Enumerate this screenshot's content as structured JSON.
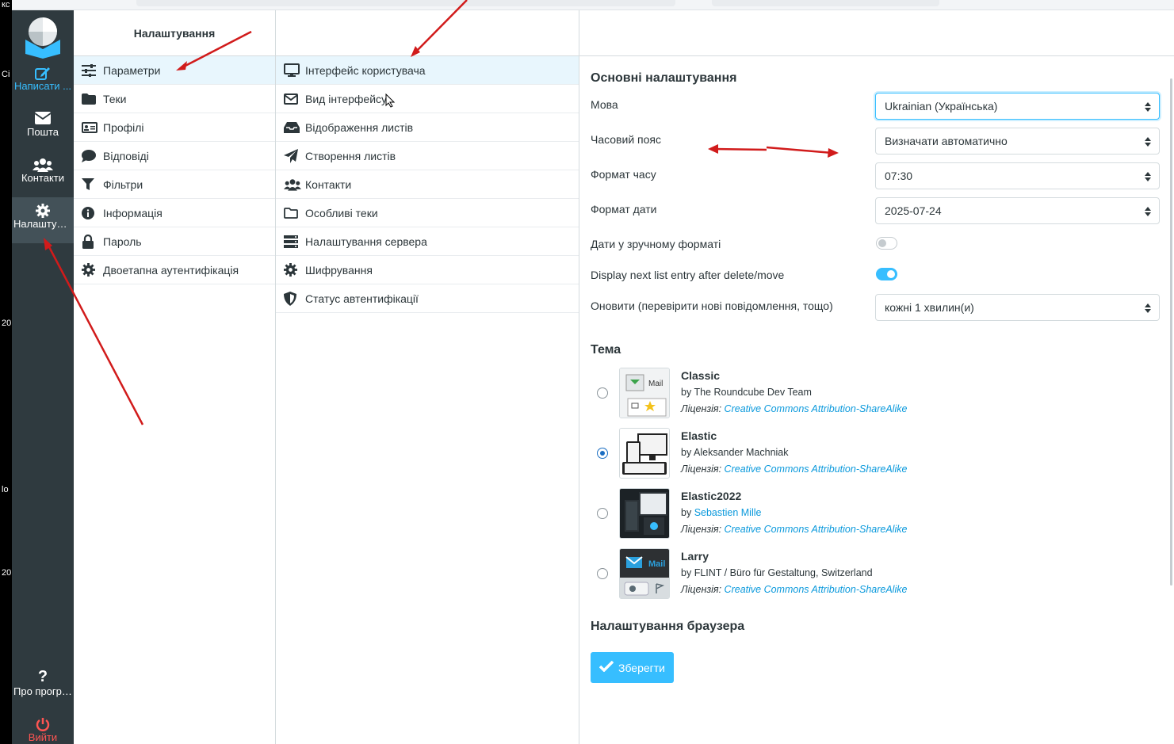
{
  "desktop_strip": {
    "fragments": [
      "кс",
      "Сі",
      "20",
      "lo",
      "20"
    ]
  },
  "rail": {
    "items": [
      {
        "label": "Написати ...",
        "icon": "compose-icon"
      },
      {
        "label": "Пошта",
        "icon": "mail-icon"
      },
      {
        "label": "Контакти",
        "icon": "contacts-icon"
      },
      {
        "label": "Налаштува...",
        "icon": "gear-icon"
      }
    ],
    "about_label": "Про програ...",
    "logout_label": "Вийти",
    "colors": {
      "accent": "#37beff",
      "bg": "#2f3a3f",
      "active_bg": "#435158",
      "logout": "#ff5552"
    }
  },
  "settings": {
    "title": "Налаштування",
    "items": [
      {
        "label": "Параметри",
        "icon": "sliders-icon"
      },
      {
        "label": "Теки",
        "icon": "folder-icon"
      },
      {
        "label": "Профілі",
        "icon": "id-card-icon"
      },
      {
        "label": "Відповіді",
        "icon": "comment-icon"
      },
      {
        "label": "Фільтри",
        "icon": "filter-icon"
      },
      {
        "label": "Інформація",
        "icon": "info-icon"
      },
      {
        "label": "Пароль",
        "icon": "lock-icon"
      },
      {
        "label": "Двоетапна аутентифікація",
        "icon": "gear-icon"
      }
    ]
  },
  "sections": {
    "items": [
      {
        "label": "Інтерфейс користувача",
        "icon": "monitor-icon"
      },
      {
        "label": "Вид інтерфейсу",
        "icon": "envelope-icon"
      },
      {
        "label": "Відображення листів",
        "icon": "inbox-icon"
      },
      {
        "label": "Створення листів",
        "icon": "paper-plane-icon"
      },
      {
        "label": "Контакти",
        "icon": "users-icon"
      },
      {
        "label": "Особливі теки",
        "icon": "folder-open-icon"
      },
      {
        "label": "Налаштування сервера",
        "icon": "server-icon"
      },
      {
        "label": "Шифрування",
        "icon": "gear-icon"
      },
      {
        "label": "Статус автентифікації",
        "icon": "shield-icon"
      }
    ]
  },
  "main": {
    "section_title": "Основні налаштування",
    "language": {
      "label": "Мова",
      "value": "Ukrainian (Українська)"
    },
    "timezone": {
      "label": "Часовий пояс",
      "value": "Визначати автоматично"
    },
    "time_format": {
      "label": "Формат часу",
      "value": "07:30"
    },
    "date_format": {
      "label": "Формат дати",
      "value": "2025-07-24"
    },
    "pretty_dates": {
      "label": "Дати у зручному форматі",
      "on": false
    },
    "display_next": {
      "label": "Display next list entry after delete/move",
      "on": true
    },
    "refresh": {
      "label": "Оновити (перевірити нові повідомлення, тощо)",
      "value": "кожні 1 хвилин(и)"
    },
    "theme_title": "Тема",
    "license_prefix": "Ліцензія:",
    "license_link": "Creative Commons Attribution-ShareAlike",
    "themes": [
      {
        "name": "Classic",
        "by": "by",
        "author": "The Roundcube Dev Team",
        "author_is_link": false,
        "checked": false,
        "thumb_text": "Mail"
      },
      {
        "name": "Elastic",
        "by": "by",
        "author": "Aleksander Machniak",
        "author_is_link": false,
        "checked": true
      },
      {
        "name": "Elastic2022",
        "by": "by",
        "author": "Sebastien Mille",
        "author_is_link": true,
        "checked": false
      },
      {
        "name": "Larry",
        "by": "by",
        "author": "FLINT / Büro für Gestaltung, Switzerland",
        "author_is_link": false,
        "checked": false,
        "thumb_text": "Mail"
      }
    ],
    "browser_title": "Налаштування браузера",
    "save_label": "Зберегти"
  }
}
